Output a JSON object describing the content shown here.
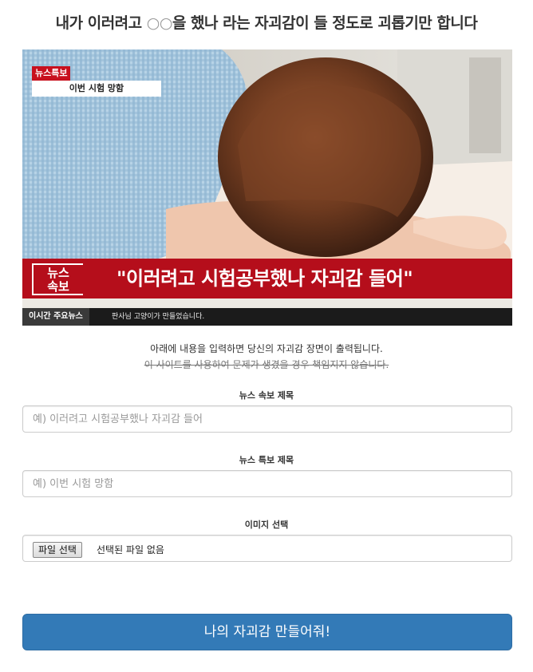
{
  "page": {
    "title_pre": "내가 이러려고 ",
    "title_mark": "○○",
    "title_post": "을 했나 라는 자괴감이 들 정도로 괴롭기만 합니다"
  },
  "preview": {
    "special_tag": "뉴스특보",
    "special_title": "이번 시험 망함",
    "breaking_badge_line1": "뉴스",
    "breaking_badge_line2": "속보",
    "breaking_headline": "\"이러려고 시험공부했나 자괴감 들어\"",
    "ticker_label": "이시간 주요뉴스",
    "ticker_text": "판사님 고양이가 만들었습니다."
  },
  "intro": {
    "info": "아래에 내용을 입력하면 당신의 자괴감 장면이 출력됩니다.",
    "disclaimer": "이 사이트를 사용하여 문제가 생겼을 경우 책임지지 않습니다."
  },
  "form": {
    "breaking_label": "뉴스 속보 제목",
    "breaking_placeholder": "예) 이러려고 시험공부했나 자괴감 들어",
    "special_label": "뉴스 특보 제목",
    "special_placeholder": "예) 이번 시험 망함",
    "image_label": "이미지 선택",
    "file_button": "파일 선택",
    "file_status": "선택된 파일 없음",
    "submit": "나의 자괴감 만들어줘!"
  },
  "colors": {
    "breaking_red": "#b50e1b",
    "primary_button": "#337ab7"
  }
}
